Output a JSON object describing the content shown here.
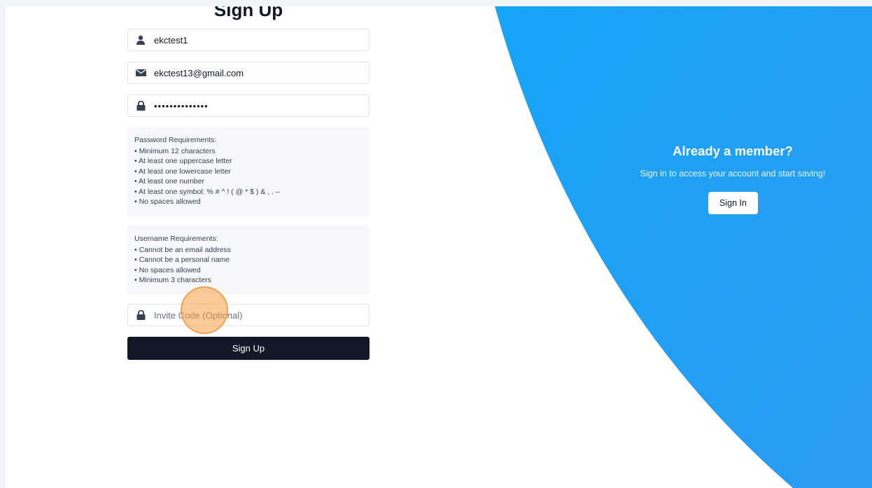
{
  "signup": {
    "title": "Sign Up",
    "username": {
      "value": "ekctest1",
      "icon": "user-icon"
    },
    "email": {
      "value": "ekctest13@gmail.com",
      "icon": "envelope-icon"
    },
    "password": {
      "value": "••••••••••••••",
      "icon": "lock-icon"
    },
    "password_requirements": {
      "title": "Password Requirements:",
      "items": [
        "• Minimum 12 characters",
        "• At least one uppercase letter",
        "• At least one lowercase letter",
        "• At least one number",
        "• At least one symbol: % # ^ ! ( @ * $ ) & , . –",
        "• No spaces allowed"
      ]
    },
    "username_requirements": {
      "title": "Username Requirements:",
      "items": [
        "• Cannot be an email address",
        "• Cannot be a personal name",
        "• No spaces allowed",
        "• Minimum 3 characters"
      ]
    },
    "invite_code": {
      "value": "",
      "placeholder": "Invite Code (Optional)",
      "icon": "lock-icon"
    },
    "submit_label": "Sign Up"
  },
  "cta": {
    "heading": "Already a member?",
    "subtext": "Sign in to access your account and start saving!",
    "button_label": "Sign In"
  },
  "colors": {
    "accent_blue": "#1ea6f6",
    "primary_button": "#111827",
    "cursor_highlight": "#f5a046"
  }
}
